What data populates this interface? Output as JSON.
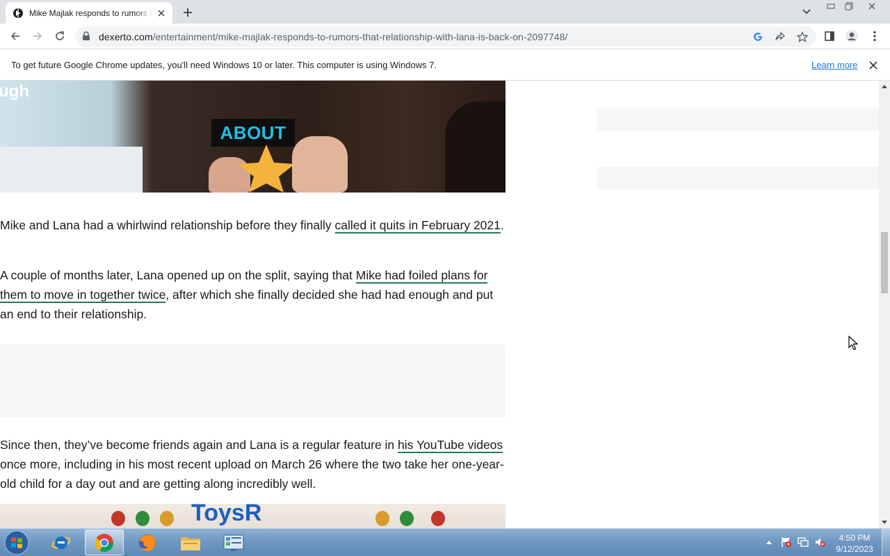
{
  "browser": {
    "tab": {
      "title": "Mike Majlak responds to rumors that relationship with Lana is back on - Dexerto",
      "favicon": "dexerto-favicon-icon"
    },
    "url": {
      "domain": "dexerto.com",
      "path": "/entertainment/mike-majlak-responds-to-rumors-that-relationship-with-lana-is-back-on-2097748/"
    },
    "infobar": {
      "message": "To get future Google Chrome updates, you'll need Windows 10 or later. This computer is using Windows 7.",
      "link": "Learn more"
    }
  },
  "article": {
    "hero_overlay_text": "ugh",
    "hero_badge_text": "ABOUT",
    "p1": {
      "text_before": "Mike and Lana had a whirlwind relationship before they finally ",
      "link": "called it quits in February 2021",
      "text_after": "."
    },
    "p2": {
      "text_before": "A couple of months later, Lana opened up on the split, saying that ",
      "link": "Mike had foiled plans for them to move in together twice",
      "text_after": ", after which she finally decided she had had enough and put an end to their relationship."
    },
    "p3": {
      "text_before": "Since then, they’ve become friends again and Lana is a regular feature in ",
      "link": "his YouTube videos",
      "text_after": " once more, including in his most recent upload on March 26 where the two take her one-year-old child for a day out and are getting along incredibly well."
    },
    "bottom_image_text": "ToysR"
  },
  "taskbar": {
    "apps": [
      "internet-explorer-icon",
      "chrome-icon",
      "firefox-icon",
      "file-explorer-icon",
      "control-panel-icon"
    ],
    "clock": {
      "time": "4:50 PM",
      "date": "9/12/2023"
    }
  },
  "colors": {
    "link_underline": "#1f7a57",
    "infobar_link": "#1a73e8",
    "hero_badge_text": "#1ec0e6"
  }
}
